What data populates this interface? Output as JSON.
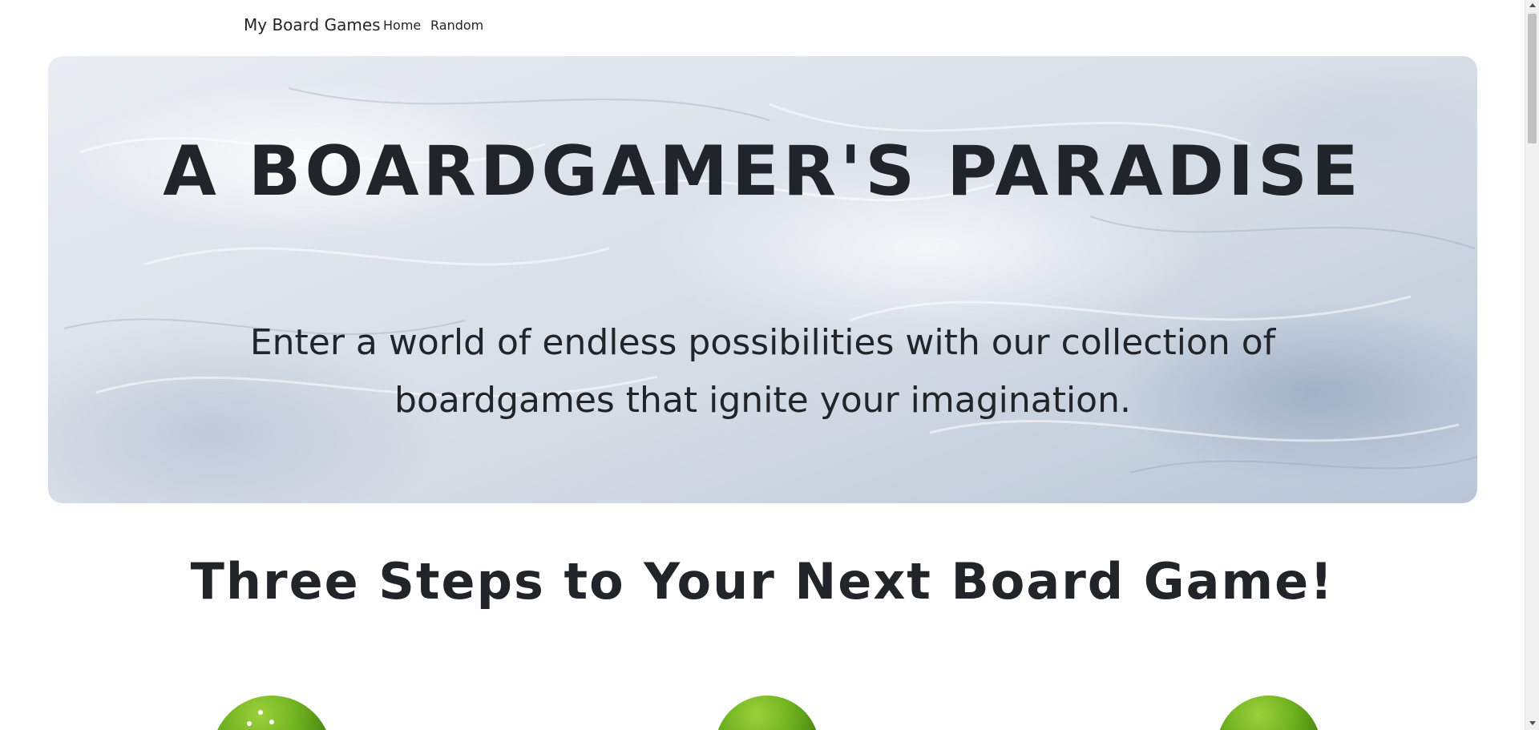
{
  "navbar": {
    "brand": "My Board Games",
    "links": [
      {
        "label": "Home"
      },
      {
        "label": "Random"
      }
    ]
  },
  "hero": {
    "title": "A BOARDGAMER'S PARADISE",
    "subtitle": "Enter a world of endless possibilities with our collection of boardgames that ignite your imagination."
  },
  "steps": {
    "heading": "Three Steps to Your Next Board Game!"
  },
  "colors": {
    "text": "#212529",
    "background": "#ffffff",
    "hero_tint": "#d3dbe5",
    "grass": "#6fb21f"
  }
}
